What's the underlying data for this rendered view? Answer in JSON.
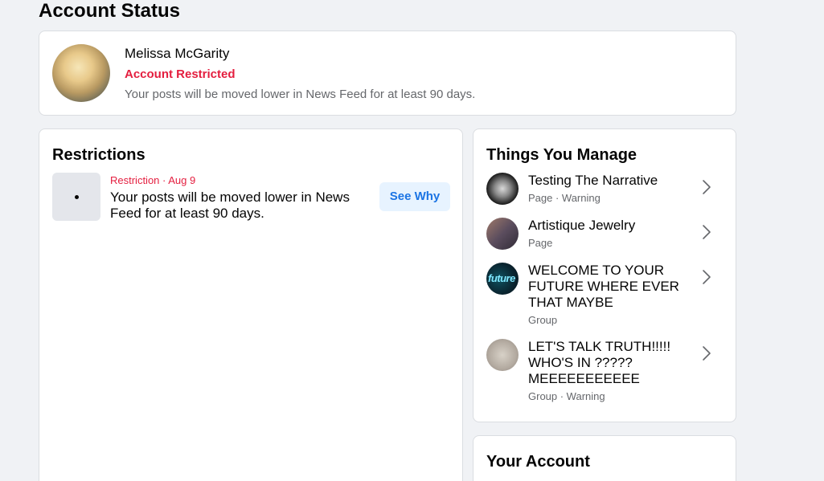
{
  "page": {
    "title": "Account Status"
  },
  "profile": {
    "name": "Melissa McGarity",
    "status": "Account Restricted",
    "description": "Your posts will be moved lower in News Feed for at least 90 days."
  },
  "restrictions": {
    "heading": "Restrictions",
    "items": [
      {
        "meta": "Restriction · Aug 9",
        "text": "Your posts will be moved lower in News Feed for at least 90 days.",
        "button": "See Why"
      }
    ]
  },
  "manage": {
    "heading": "Things You Manage",
    "items": [
      {
        "title": "Testing The Narrative",
        "sub": "Page · Warning",
        "icon": "page-avatar"
      },
      {
        "title": "Artistique Jewelry",
        "sub": "Page",
        "icon": "page-avatar"
      },
      {
        "title": "WELCOME TO YOUR FUTURE WHERE EVER THAT MAYBE",
        "sub": "Group",
        "icon": "group-avatar",
        "avatar_text": "future"
      },
      {
        "title": "LET'S TALK TRUTH!!!!! WHO'S IN ????? MEEEEEEEEEEE",
        "sub": "Group · Warning",
        "icon": "group-avatar"
      }
    ]
  },
  "account": {
    "heading": "Your Account"
  },
  "colors": {
    "warning_red": "#e41e3f",
    "link_blue": "#1b74e4",
    "background": "#f0f2f5"
  }
}
